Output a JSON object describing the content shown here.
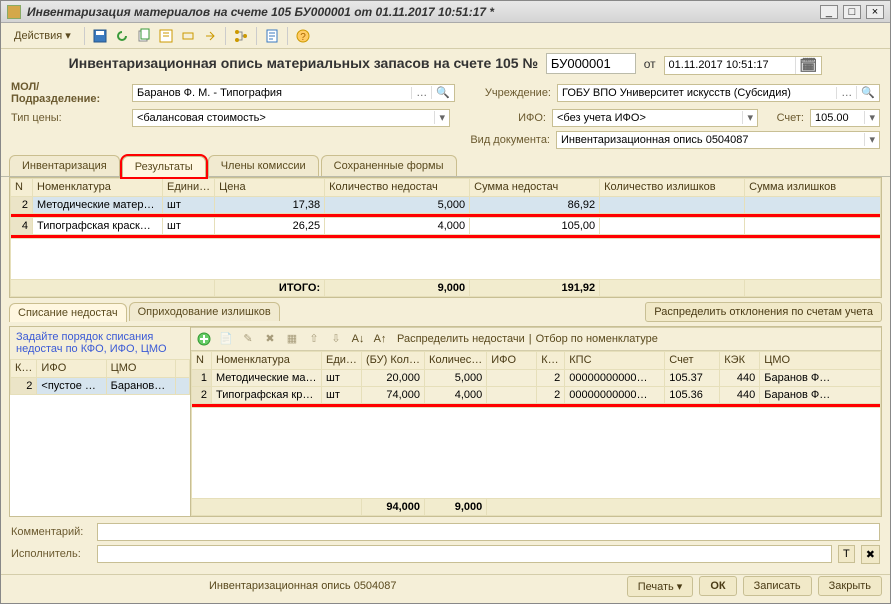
{
  "window": {
    "title": "Инвентаризация материалов на счете 105 БУ000001 от 01.11.2017 10:51:17 *"
  },
  "toolbar": {
    "actions": "Действия"
  },
  "header": {
    "title_prefix": "Инвентаризационная опись материальных запасов на счете 105 №",
    "number": "БУ000001",
    "from": "от",
    "date": "01.11.2017 10:51:17"
  },
  "f": {
    "mol_label": "МОЛ/Подразделение:",
    "mol_value": "Баранов Ф. М. - Типография",
    "uch_label": "Учреждение:",
    "uch_value": "ГОБУ ВПО Университет искусств (Субсидия)",
    "tipcen_label": "Тип цены:",
    "tipcen_value": "<балансовая стоимость>",
    "ifo_label": "ИФО:",
    "ifo_value": "<без учета ИФО>",
    "schet_label": "Счет:",
    "schet_value": "105.00",
    "viddoc_label": "Вид документа:",
    "viddoc_value": "Инвентаризационная опись 0504087"
  },
  "main_tabs": [
    "Инвентаризация",
    "Результаты",
    "Члены комиссии",
    "Сохраненные формы"
  ],
  "main_tabs_active": 1,
  "grid1": {
    "cols": [
      "N",
      "Номенклатура",
      "Едини…",
      "Цена",
      "Количество недостач",
      "Сумма недостач",
      "Количество излишков",
      "Сумма излишков"
    ],
    "rows": [
      {
        "n": "2",
        "nom": "Методические матер…",
        "ed": "шт",
        "price": "17,38",
        "qn": "5,000",
        "sn": "86,92",
        "qi": "",
        "si": ""
      },
      {
        "n": "4",
        "nom": "Типографская краск…",
        "ed": "шт",
        "price": "26,25",
        "qn": "4,000",
        "sn": "105,00",
        "qi": "",
        "si": ""
      }
    ],
    "itogo_label": "ИТОГО:",
    "itogo_qn": "9,000",
    "itogo_sn": "191,92"
  },
  "sub_tabs": [
    "Списание недостач",
    "Оприходование излишков"
  ],
  "dist_button": "Распределить отклонения по счетам учета",
  "left_panel": {
    "hint": "Задайте порядок списания недостач по КФО, ИФО, ЦМО",
    "cols": [
      "К…",
      "ИФО",
      "ЦМО"
    ],
    "row": {
      "k": "2",
      "ifo": "<пустое …",
      "cmo": "Баранов…"
    }
  },
  "right_toolbar": {
    "dist": "Распределить недостачи",
    "filter": "Отбор по номенклатуре"
  },
  "grid2": {
    "cols": [
      "N",
      "Номенклатура",
      "Еди…",
      "(БУ) Кол…",
      "Количес…",
      "ИФО",
      "К…",
      "КПС",
      "Счет",
      "КЭК",
      "ЦМО"
    ],
    "rows": [
      {
        "n": "1",
        "nom": "Методические ма…",
        "ed": "шт",
        "bukol": "20,000",
        "kol": "5,000",
        "ifo": "",
        "k": "2",
        "kps": "00000000000…",
        "schet": "105.37",
        "kek": "440",
        "cmo": "Баранов Ф…"
      },
      {
        "n": "2",
        "nom": "Типографская кр…",
        "ed": "шт",
        "bukol": "74,000",
        "kol": "4,000",
        "ifo": "",
        "k": "2",
        "kps": "00000000000…",
        "schet": "105.36",
        "kek": "440",
        "cmo": "Баранов Ф…"
      }
    ],
    "tot_bu": "94,000",
    "tot_kol": "9,000"
  },
  "bottom": {
    "comment_label": "Комментарий:",
    "exec_label": "Исполнитель:"
  },
  "status": {
    "doc": "Инвентаризационная опись 0504087",
    "print": "Печать",
    "ok": "ОК",
    "save": "Записать",
    "close": "Закрыть"
  }
}
